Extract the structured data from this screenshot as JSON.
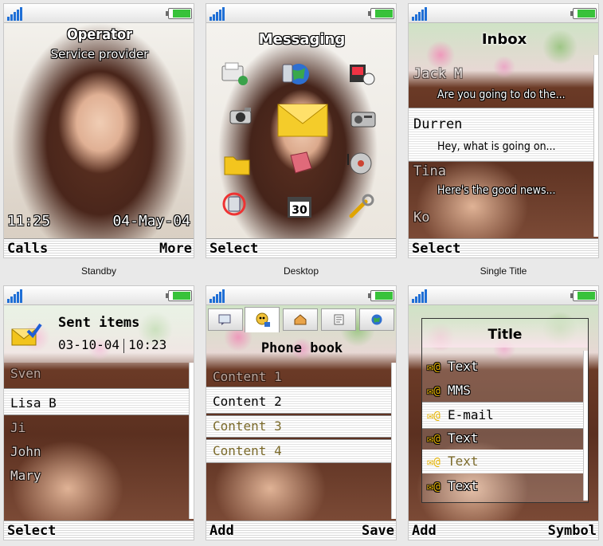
{
  "colors": {
    "signal": "#1f6fd6",
    "battery": "#38c23a",
    "muted_text": "#7b6a2a"
  },
  "captions": [
    "Standby",
    "Desktop",
    "Single Title"
  ],
  "standby": {
    "operator": "Operator",
    "provider": "Service provider",
    "time": "11:25",
    "date": "04-May-04",
    "softkeys": {
      "left": "Calls",
      "right": "More"
    }
  },
  "desktop": {
    "title": "Messaging",
    "icons": [
      "fax-icon",
      "phone-globe-icon",
      "media-icon",
      "camera-icon",
      "envelope-icon",
      "radio-icon",
      "folder-icon",
      "book-icon",
      "music-disc-icon",
      "sync-phone-icon",
      "calendar-icon",
      "wrench-icon"
    ],
    "calendar_day": "30",
    "softkeys": {
      "left": "Select"
    }
  },
  "inbox": {
    "title": "Inbox",
    "messages": [
      {
        "from": "Jack M",
        "preview": "Are you going to do the..."
      },
      {
        "from": "Durren",
        "preview": "Hey, what is going on..."
      },
      {
        "from": "Tina",
        "preview": "Here's the good news..."
      },
      {
        "from": "Ko",
        "preview": ""
      }
    ],
    "softkeys": {
      "left": "Select"
    }
  },
  "sent": {
    "title": "Sent items",
    "date": "03-10-04",
    "time": "10:23",
    "items": [
      "Sven",
      "Lisa B",
      "Ji",
      "John",
      "Mary"
    ],
    "softkeys": {
      "left": "Select"
    }
  },
  "phonebook": {
    "title": "Phone book",
    "tabs": [
      "message-tab-icon",
      "contact-tab-icon",
      "home-tab-icon",
      "notes-tab-icon",
      "globe-tab-icon"
    ],
    "items": [
      "Content 1",
      "Content 2",
      "Content 3",
      "Content 4"
    ],
    "softkeys": {
      "left": "Add",
      "right": "Save"
    }
  },
  "symbol": {
    "title": "Title",
    "items": [
      "Text",
      "MMS",
      "E-mail",
      "Text",
      "Text",
      "Text"
    ],
    "softkeys": {
      "left": "Add",
      "right": "Symbol"
    }
  }
}
